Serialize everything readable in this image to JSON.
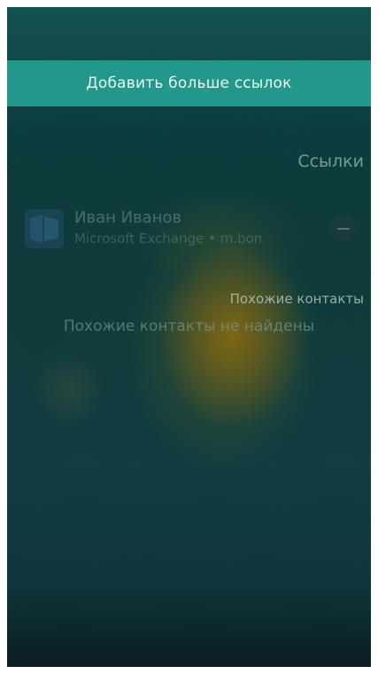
{
  "add_links": {
    "label": "Добавить больше ссылок"
  },
  "links_section": {
    "heading": "Ссылки",
    "contacts": [
      {
        "name": "Иван Иванов",
        "source": "Microsoft Exchange • m.bon"
      }
    ]
  },
  "similar_section": {
    "heading": "Похожие контакты",
    "empty_text": "Похожие контакты не найдены"
  },
  "icons": {
    "avatar": "contact-avatar-icon",
    "remove": "remove-link-icon"
  },
  "colors": {
    "accent_bar": "#23978c",
    "background_top": "#0f5250",
    "background_bottom": "#081c22"
  }
}
